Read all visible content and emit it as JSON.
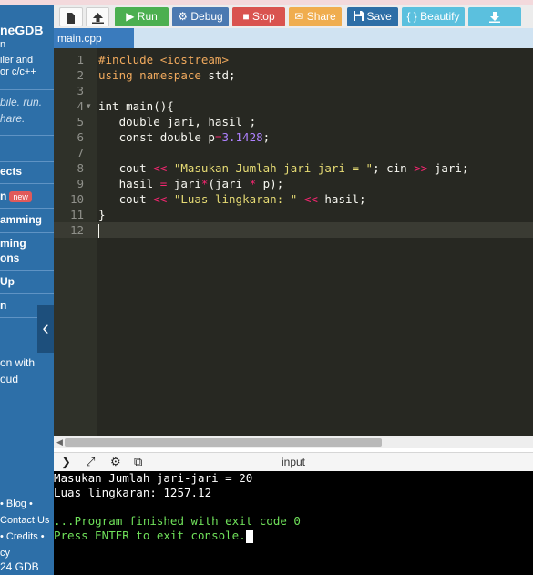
{
  "sidebar": {
    "brand": "neGDB",
    "sub1": "n",
    "sub2": "iler and",
    "sub3": "or c/c++",
    "tag1": "bile. run.",
    "tag2": "hare.",
    "items": [
      {
        "label": "ects"
      },
      {
        "label": "n",
        "badge": "new"
      },
      {
        "label": "amming"
      },
      {
        "label": "ming"
      },
      {
        "label": "ons"
      },
      {
        "label": "Up"
      },
      {
        "label": "n"
      }
    ],
    "note1": "on with",
    "note2": "oud",
    "footer": [
      "• Blog •",
      "Contact Us",
      "• Credits •",
      "cy"
    ],
    "gdb": "24 GDB"
  },
  "toolbar": {
    "run": "Run",
    "debug": "Debug",
    "stop": "Stop",
    "share": "Share",
    "save": "Save",
    "beautify": "{ } Beautify"
  },
  "file_tab": "main.cpp",
  "editor": {
    "lines": [
      {
        "n": "1",
        "html": "<span class='k-or'>#include &lt;iostream&gt;</span>"
      },
      {
        "n": "2",
        "html": "<span class='k-or'>using</span> <span class='k-or'>namespace</span> std;"
      },
      {
        "n": "3",
        "html": ""
      },
      {
        "n": "4",
        "html": "int main(){"
      },
      {
        "n": "5",
        "html": "   double jari, hasil ;"
      },
      {
        "n": "6",
        "html": "   const double p<span class='k-pk'>=</span><span class='k-num'>3.1428</span>;"
      },
      {
        "n": "7",
        "html": ""
      },
      {
        "n": "8",
        "html": "   cout <span class='k-pk'>&lt;&lt;</span> <span class='k-str'>\"Masukan Jumlah jari-jari = \"</span>; cin <span class='k-pk'>&gt;&gt;</span> jari;"
      },
      {
        "n": "9",
        "html": "   hasil <span class='k-pk'>=</span> jari<span class='k-pk'>*</span>(jari <span class='k-pk'>*</span> p);"
      },
      {
        "n": "10",
        "html": "   cout <span class='k-pk'>&lt;&lt;</span> <span class='k-str'>\"Luas lingkaran: \"</span> <span class='k-pk'>&lt;&lt;</span> hasil;"
      },
      {
        "n": "11",
        "html": "}"
      },
      {
        "n": "12",
        "html": ""
      }
    ]
  },
  "console": {
    "title": "input",
    "lines": [
      "Masukan Jumlah jari-jari = 20",
      "Luas lingkaran: 1257.12",
      "",
      "...Program finished with exit code 0",
      "Press ENTER to exit console."
    ]
  }
}
